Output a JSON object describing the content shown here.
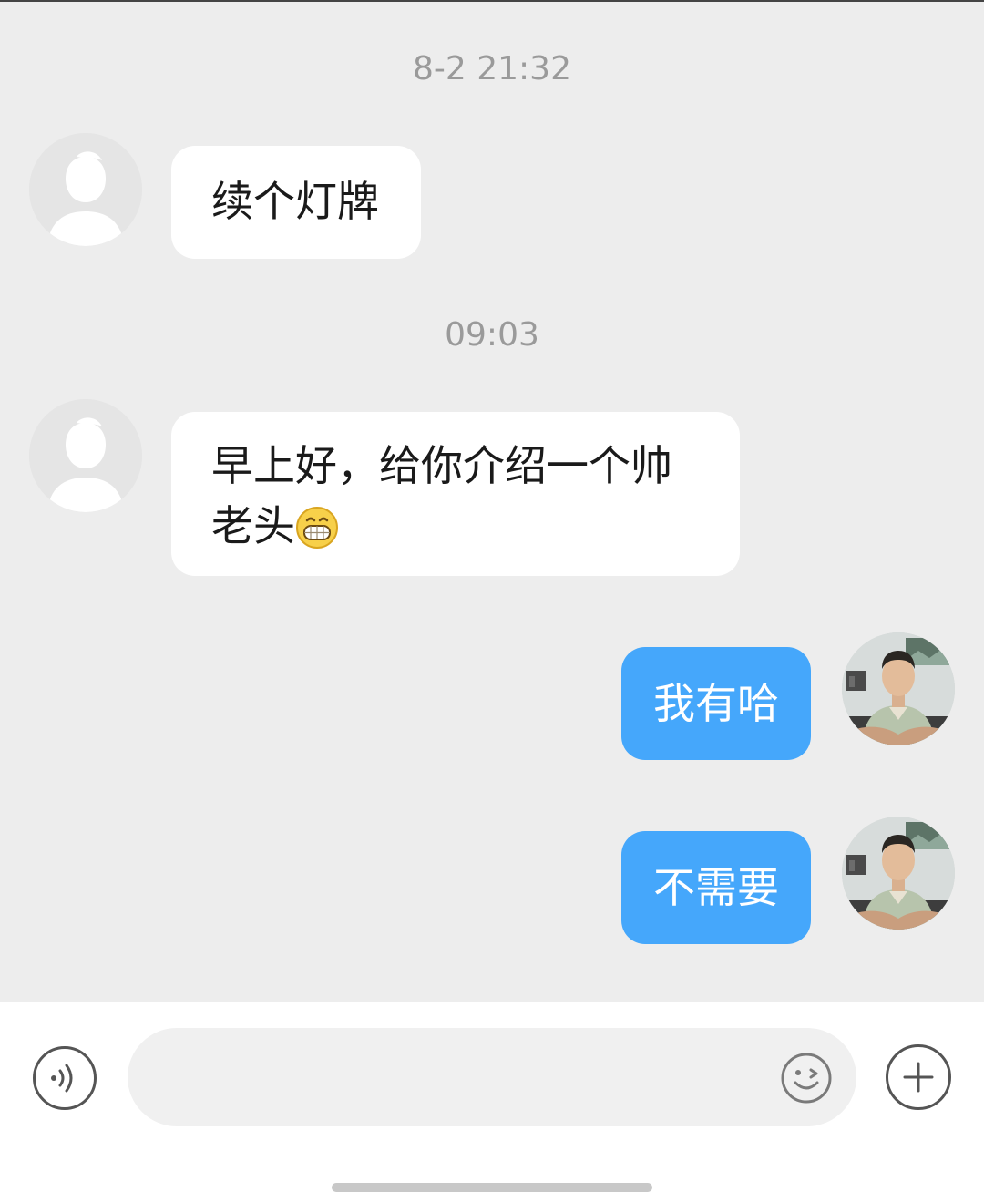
{
  "messages": [
    {
      "timestamp": "8-2 21:32",
      "direction": "incoming",
      "avatar": "default-avatar",
      "text": "续个灯牌"
    },
    {
      "timestamp": "09:03",
      "direction": "incoming",
      "avatar": "default-avatar",
      "line1": "早上好，给你介绍一个帅",
      "line2": "老头",
      "emoji": "grinning-face"
    },
    {
      "direction": "outgoing",
      "avatar": "user-photo-avatar",
      "text": "我有哈"
    },
    {
      "direction": "outgoing",
      "avatar": "user-photo-avatar",
      "text": "不需要"
    }
  ],
  "input_bar": {
    "voice_icon": "voice-input-icon",
    "message_input_value": "",
    "emoji_icon": "emoji-icon",
    "more_icon": "plus-icon"
  },
  "colors": {
    "background": "#ededed",
    "incoming_bubble": "#ffffff",
    "outgoing_bubble": "#45a7fb",
    "timestamp_text": "#9a9a9a"
  }
}
